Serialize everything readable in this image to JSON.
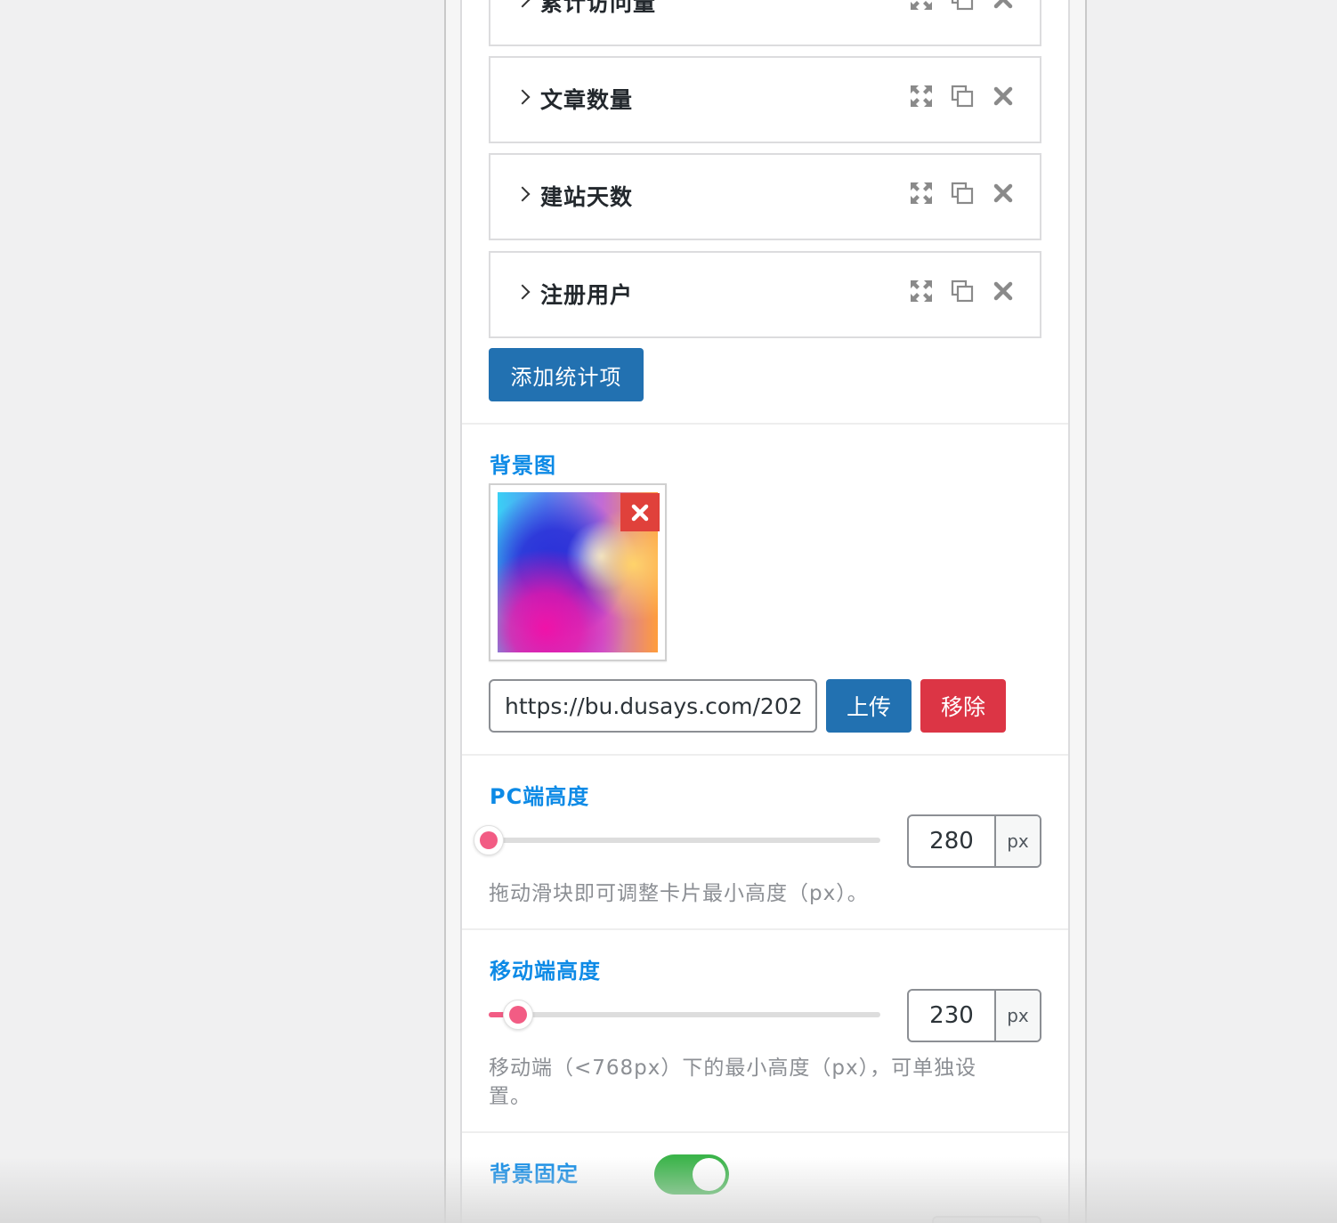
{
  "stat_items": [
    {
      "title": "累计访问量"
    },
    {
      "title": "文章数量"
    },
    {
      "title": "建站天数"
    },
    {
      "title": "注册用户"
    }
  ],
  "add_stat_label": "添加统计项",
  "background_image": {
    "label": "背景图",
    "url_value": "https://bu.dusays.com/202",
    "upload_label": "上传",
    "remove_label": "移除"
  },
  "pc_height": {
    "label": "PC端高度",
    "value": "280",
    "unit": "px",
    "slider_fraction": 0,
    "help": "拖动滑块即可调整卡片最小高度（px）。"
  },
  "mobile_height": {
    "label": "移动端高度",
    "value": "230",
    "unit": "px",
    "slider_fraction": 0.075,
    "help": "移动端（<768px）下的最小高度（px），可单独设置。"
  },
  "bg_fixed": {
    "label": "背景固定",
    "enabled": true
  },
  "colors": {
    "primary_button": "#2271b1",
    "danger_button": "#dc3545",
    "label_blue": "#0d8ae6",
    "slider_accent": "#f25c84",
    "toggle_on": "#3bb44a"
  }
}
